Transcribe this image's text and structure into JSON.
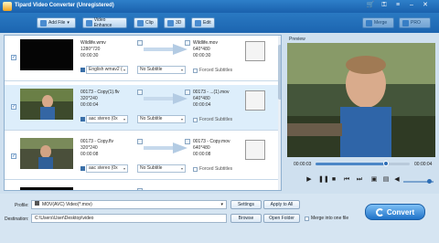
{
  "app": {
    "title": "Tipard Video Converter (Unregistered)"
  },
  "toolbar": {
    "add_file": "Add File",
    "video_enhance": "Video Enhance",
    "clip": "Clip",
    "three_d": "3D",
    "edit": "Edit",
    "merge": "Merge",
    "more": "PRO"
  },
  "files": [
    {
      "name": "Wildlife.wmv",
      "resolution": "1280*720",
      "duration": "00:00:30",
      "out_name": "Wildlife.mov",
      "out_resolution": "640*480",
      "out_duration": "00:00:30",
      "audio": "English wmav2 (",
      "subtitle": "No Subtitle",
      "forced": "Forced Subtitles",
      "checked": true,
      "selected": false
    },
    {
      "name": "00173 - Copy(1).flv",
      "resolution": "320*240",
      "duration": "00:00:04",
      "out_name": "00173 - ...(1).mov",
      "out_resolution": "640*480",
      "out_duration": "00:00:04",
      "audio": "aac stereo (0x",
      "subtitle": "No Subtitle",
      "forced": "Forced Subtitles",
      "checked": true,
      "selected": true
    },
    {
      "name": "00173 - Copy.flv",
      "resolution": "320*240",
      "duration": "00:00:08",
      "out_name": "00173 - Copy.mov",
      "out_resolution": "640*480",
      "out_duration": "00:00:08",
      "audio": "aac stereo (0x",
      "subtitle": "No Subtitle",
      "forced": "Forced Subtitles",
      "checked": true,
      "selected": false
    },
    {
      "name": "",
      "resolution": "",
      "duration": "",
      "out_name": "",
      "out_resolution": "",
      "out_duration": "",
      "audio": "",
      "subtitle": "",
      "forced": "",
      "checked": true,
      "selected": false
    }
  ],
  "preview": {
    "label": "Preview",
    "time_current": "00:00:03",
    "time_total": "00:00:04",
    "progress": 0.75,
    "volume": 0.85
  },
  "bottom": {
    "profile_label": "Profile:",
    "profile_value": "MOV(AVC) Video(*.mov)",
    "settings": "Settings",
    "apply_all": "Apply to All",
    "destination_label": "Destination:",
    "destination_value": "C:\\Users\\User\\Desktop\\video",
    "browse": "Browse",
    "open_folder": "Open Folder",
    "merge_label": "Merge into one file",
    "convert": "Convert"
  },
  "colors": {
    "accent": "#1f72c8",
    "titlebar": "#2e7fc9",
    "selected_row": "#ddeefb"
  }
}
